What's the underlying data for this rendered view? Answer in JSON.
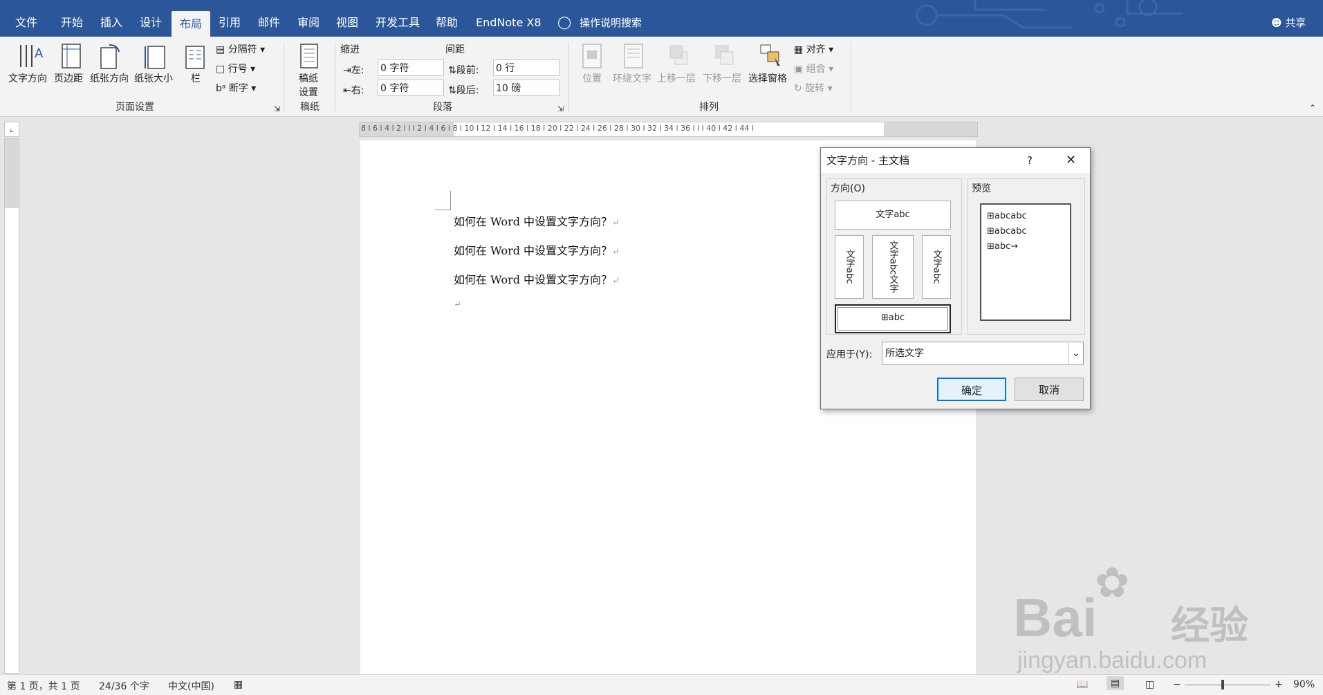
{
  "menu": {
    "tabs": [
      "文件",
      "开始",
      "插入",
      "设计",
      "布局",
      "引用",
      "邮件",
      "审阅",
      "视图",
      "开发工具",
      "帮助",
      "EndNote X8"
    ],
    "active_tab": "布局",
    "search_label": "操作说明搜索",
    "share_label": "共享"
  },
  "ribbon": {
    "page_setup": {
      "buttons": [
        "文字方向",
        "页边距",
        "纸张方向",
        "纸张大小",
        "栏"
      ],
      "small": [
        "分隔符",
        "行号",
        "断字"
      ],
      "group_label": "页面设置"
    },
    "manuscript": {
      "button_line1": "稿纸",
      "button_line2": "设置",
      "group_label": "稿纸"
    },
    "paragraph": {
      "indent_header": "缩进",
      "spacing_header": "间距",
      "left_label": "左:",
      "left_value": "0 字符",
      "right_label": "右:",
      "right_value": "0 字符",
      "before_label": "段前:",
      "before_value": "0 行",
      "after_label": "段后:",
      "after_value": "10 磅",
      "group_label": "段落"
    },
    "arrange": {
      "buttons": [
        "位置",
        "环绕文字",
        "上移一层",
        "下移一层",
        "选择窗格"
      ],
      "small": [
        "对齐",
        "组合",
        "旋转"
      ],
      "group_label": "排列"
    }
  },
  "ruler": {
    "labels": "8 l 6 l 4 l 2 l  l  l 2 l 4 l 6 l 8 l 10 l 12 l 14 l 16 l 18 l 20 l 22 l 24 l 26 l 28 l 30 l 32 l 34 l 36 l  l  l 40 l 42 l 44 l"
  },
  "document": {
    "lines": [
      "如何在 Word 中设置文字方向？",
      "如何在 Word 中设置文字方向？",
      "如何在 Word 中设置文字方向？"
    ]
  },
  "dialog": {
    "title": "文字方向 - 主文档",
    "help": "?",
    "direction_label": "方向(O)",
    "preview_label": "预览",
    "options": {
      "horizontal": "文字abc",
      "vertical_left": "文字abc",
      "vertical_middle": "文字abc文字",
      "vertical_right": "文字abc",
      "selected_rotated": "abc"
    },
    "preview_lines": [
      "abcabc",
      "abcabc",
      "abc"
    ],
    "apply_label": "应用于(Y):",
    "apply_value": "所选文字",
    "ok": "确定",
    "cancel": "取消"
  },
  "status": {
    "page": "第 1 页，共 1 页",
    "words": "24/36 个字",
    "language": "中文(中国)",
    "zoom": "90%"
  },
  "watermark": {
    "brand": "Bai",
    "brand_cn": "经验",
    "url": "jingyan.baidu.com"
  }
}
